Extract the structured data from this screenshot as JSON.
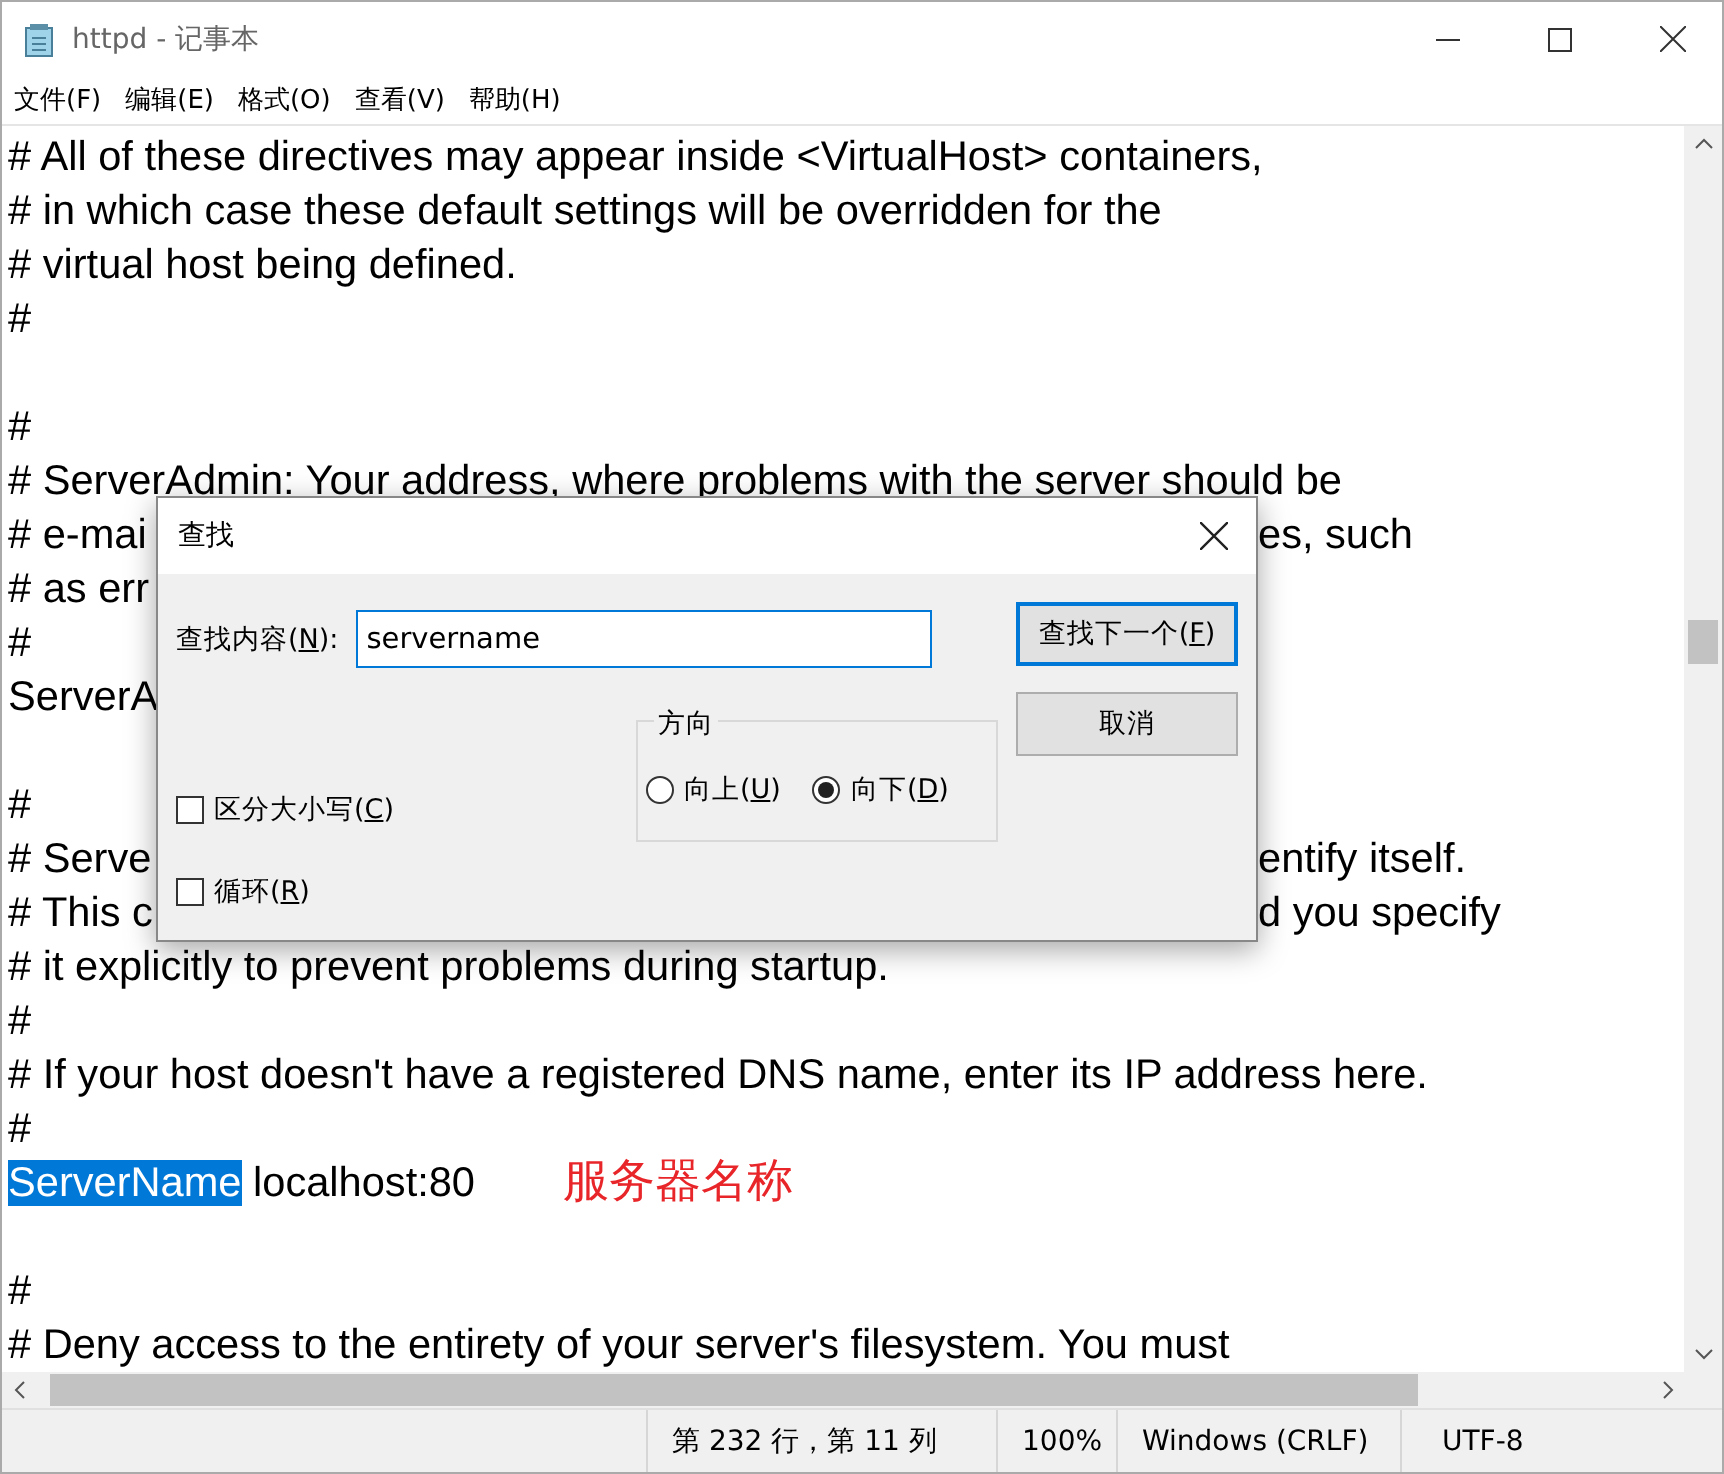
{
  "window": {
    "title": "httpd - 记事本"
  },
  "menu": [
    "文件(F)",
    "编辑(E)",
    "格式(O)",
    "查看(V)",
    "帮助(H)"
  ],
  "lines": [
    {
      "kind": "text",
      "text": "# All of these directives may appear inside <VirtualHost> containers,"
    },
    {
      "kind": "text",
      "text": "# in which case these default settings will be overridden for the"
    },
    {
      "kind": "text",
      "text": "# virtual host being defined."
    },
    {
      "kind": "text",
      "text": "#"
    },
    {
      "kind": "blank"
    },
    {
      "kind": "text",
      "text": "#"
    },
    {
      "kind": "text",
      "text": "# ServerAdmin: Your address, where problems with the server should be"
    },
    {
      "kind": "text",
      "text": "# e-mai",
      "tail": "es, such"
    },
    {
      "kind": "text",
      "text": "# as err"
    },
    {
      "kind": "text",
      "text": "#"
    },
    {
      "kind": "text",
      "text": "ServerA"
    },
    {
      "kind": "blank"
    },
    {
      "kind": "text",
      "text": "#"
    },
    {
      "kind": "text",
      "text": "# Serve",
      "tail": "entify itself."
    },
    {
      "kind": "text",
      "text": "# This c",
      "tail": "d you specify"
    },
    {
      "kind": "text",
      "text": "# it explicitly to prevent problems during startup."
    },
    {
      "kind": "text",
      "text": "#"
    },
    {
      "kind": "text",
      "text": "# If your host doesn't have a registered DNS name, enter its IP address here."
    },
    {
      "kind": "text",
      "text": "#"
    },
    {
      "kind": "text",
      "selected_text": "ServerName",
      "text": " localhost:80",
      "note": "服务器名称"
    },
    {
      "kind": "blank"
    },
    {
      "kind": "text",
      "text": "#"
    },
    {
      "kind": "text",
      "text": "# Deny access to the entirety of your server's filesystem. You must"
    }
  ],
  "find_dialog": {
    "title": "查找",
    "label": "查找内容(N):",
    "value": "servername",
    "checkboxes": [
      {
        "label": "区分大小写(C)",
        "checked": false
      },
      {
        "label": "循环(R)",
        "checked": false
      }
    ],
    "direction": {
      "legend": "方向",
      "options": [
        {
          "label": "向上(U)",
          "selected": false
        },
        {
          "label": "向下(D)",
          "selected": true
        }
      ]
    },
    "buttons": [
      {
        "label": "查找下一个(F)",
        "focused": true
      },
      {
        "label": "取消",
        "focused": false
      }
    ]
  },
  "status_bar": [
    "第 232 行，第 11 列",
    "100%",
    "Windows (CRLF)",
    "UTF-8"
  ]
}
